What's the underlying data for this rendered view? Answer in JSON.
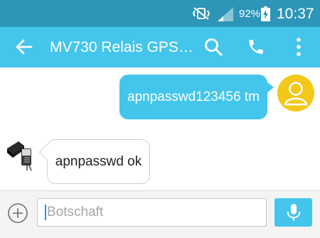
{
  "status_bar": {
    "battery_percent": "92%",
    "time": "10:37",
    "icons": [
      "mute-vibrate-icon",
      "signal-icon",
      "battery-charging-icon"
    ]
  },
  "app_bar": {
    "title": "MV730 Relais GPS…",
    "icons": [
      "back-arrow-icon",
      "search-icon",
      "phone-icon",
      "more-vert-icon"
    ]
  },
  "messages": [
    {
      "direction": "outgoing",
      "text": "apnpasswd123456 tm"
    },
    {
      "direction": "incoming",
      "text": "apnpasswd ok"
    }
  ],
  "composer": {
    "placeholder": "Botschaft",
    "icons": [
      "add-circle-icon",
      "microphone-icon"
    ]
  },
  "colors": {
    "status_bar": "#2d95b8",
    "accent": "#44c5ec",
    "avatar": "#f4c81a",
    "composer_bg": "#f4f4f4"
  }
}
